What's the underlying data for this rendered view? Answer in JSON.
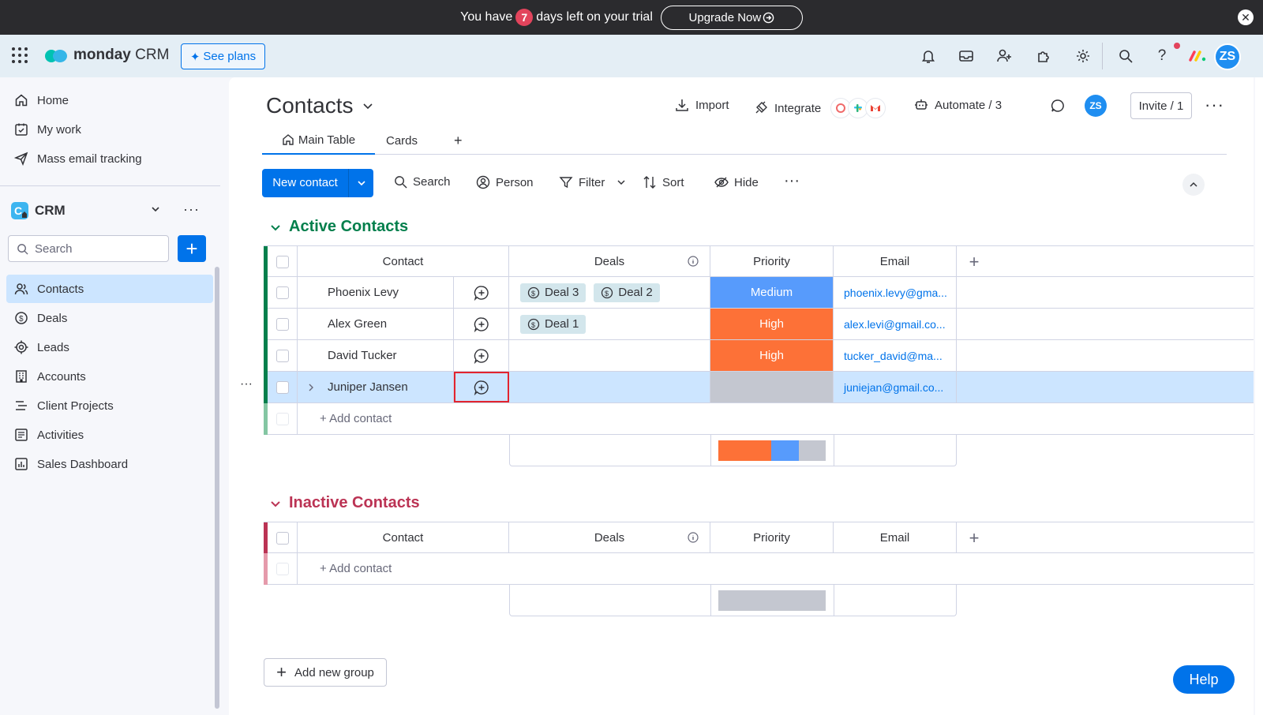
{
  "trial": {
    "prefix": "You have",
    "days": "7",
    "suffix": "days left on your trial",
    "upgrade_label": "Upgrade Now"
  },
  "topnav": {
    "brand": "monday",
    "product": "CRM",
    "see_plans": "See plans",
    "avatar_initials": "ZS"
  },
  "sidebar": {
    "items": [
      {
        "label": "Home",
        "icon": "home-icon"
      },
      {
        "label": "My work",
        "icon": "calendar-check-icon"
      },
      {
        "label": "Mass email tracking",
        "icon": "send-icon"
      }
    ],
    "workspace": "CRM",
    "search_placeholder": "Search",
    "boards": [
      {
        "label": "Contacts",
        "icon": "contacts-icon",
        "active": true
      },
      {
        "label": "Deals",
        "icon": "dollar-icon"
      },
      {
        "label": "Leads",
        "icon": "target-icon"
      },
      {
        "label": "Accounts",
        "icon": "building-icon"
      },
      {
        "label": "Client Projects",
        "icon": "list-icon"
      },
      {
        "label": "Activities",
        "icon": "activities-icon"
      },
      {
        "label": "Sales Dashboard",
        "icon": "chart-icon"
      }
    ]
  },
  "header": {
    "title": "Contacts",
    "import": "Import",
    "integrate": "Integrate",
    "automate": "Automate / 3",
    "avatar_initials": "ZS",
    "invite": "Invite / 1"
  },
  "tabs": [
    {
      "label": "Main Table"
    },
    {
      "label": "Cards"
    }
  ],
  "toolbar": {
    "new_contact": "New contact",
    "search": "Search",
    "person": "Person",
    "filter": "Filter",
    "sort": "Sort",
    "hide": "Hide"
  },
  "columns": {
    "contact": "Contact",
    "deals": "Deals",
    "priority": "Priority",
    "email": "Email"
  },
  "colors": {
    "active_group": "#037f4c",
    "inactive_group": "#bb3354",
    "medium": "#579bfc",
    "high": "#fd7137",
    "empty": "#c4c7d0",
    "accent": "#0073ea"
  },
  "active_group": {
    "title": "Active Contacts",
    "add_label": "+ Add contact",
    "rows": [
      {
        "name": "Phoenix Levy",
        "deals": [
          "Deal 3",
          "Deal 2"
        ],
        "priority": "Medium",
        "email": "phoenix.levy@gma..."
      },
      {
        "name": "Alex Green",
        "deals": [
          "Deal 1"
        ],
        "priority": "High",
        "email": "alex.levi@gmail.co..."
      },
      {
        "name": "David Tucker",
        "deals": [],
        "priority": "High",
        "email": "tucker_david@ma..."
      },
      {
        "name": "Juniper Jansen",
        "deals": [],
        "priority": "",
        "email": "juniejan@gmail.co..."
      }
    ]
  },
  "inactive_group": {
    "title": "Inactive Contacts",
    "add_label": "+ Add contact"
  },
  "add_group": "Add new group",
  "help": "Help"
}
